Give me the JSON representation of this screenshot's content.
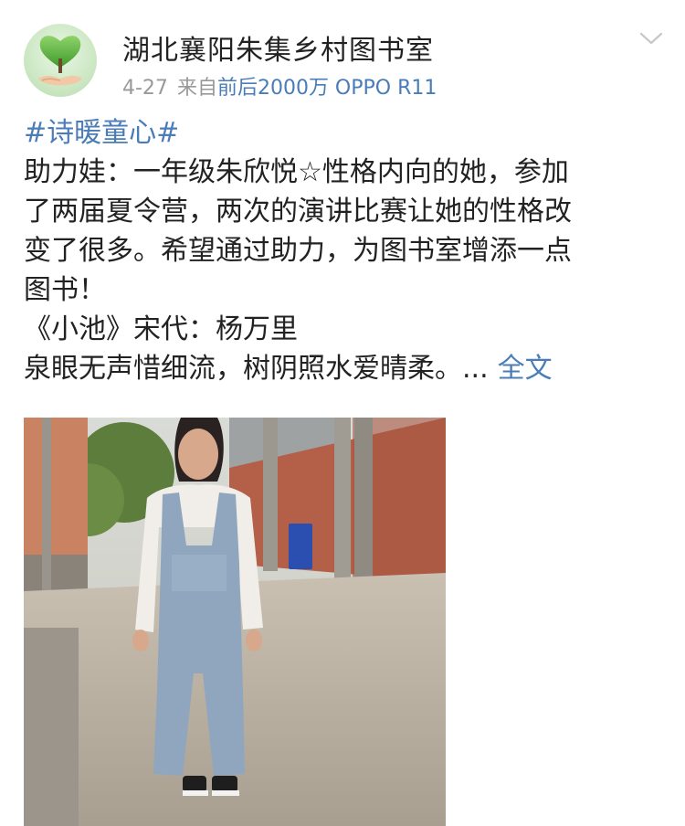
{
  "post": {
    "author": "湖北襄阳朱集乡村图书室",
    "date": "4-27",
    "source_prefix": "来自",
    "source_device": "前后2000万 OPPO R11",
    "topic": "#诗暖童心#",
    "text_line1": "助力娃：一年级朱欣悦☆性格内向的她，参加",
    "text_line2": "了两届夏令营，两次的演讲比赛让她的性格改",
    "text_line3": "变了很多。希望通过助力，为图书室增添一点",
    "text_line4": "图书！",
    "poem_title_line": "《小池》宋代：杨万里",
    "poem_first_line": "泉眼无声惜细流，树阴照水爱晴柔。...",
    "read_more": "全文"
  },
  "icons": {
    "avatar": "heart-tree-in-hands-avatar",
    "menu": "chevron-down-icon"
  },
  "colors": {
    "link": "#4a7db8",
    "meta_gray": "#999999",
    "text": "#222222"
  }
}
